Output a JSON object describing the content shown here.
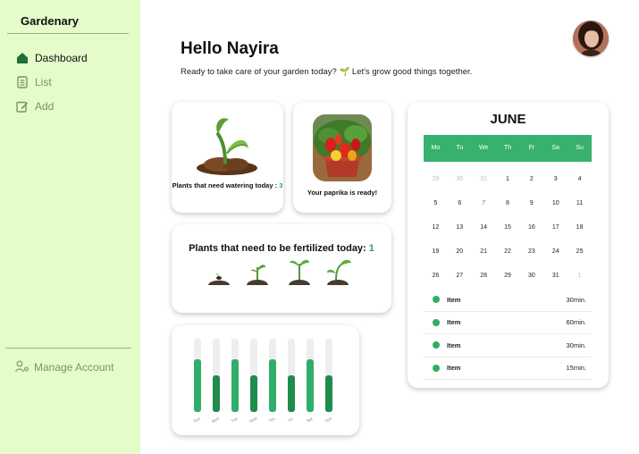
{
  "app": {
    "name": "Gardenary"
  },
  "sidebar": {
    "items": [
      {
        "label": "Dashboard",
        "icon": "home-icon",
        "active": true
      },
      {
        "label": "List",
        "icon": "list-icon",
        "active": false
      },
      {
        "label": "Add",
        "icon": "edit-icon",
        "active": false
      }
    ],
    "manage_account": {
      "label": "Manage Account",
      "icon": "user-gear-icon"
    }
  },
  "header": {
    "greeting": "Hello Nayira",
    "subtitle": "Ready to take care of your garden today? 🌱 Let's grow good things together."
  },
  "cards": {
    "watering": {
      "label": "Plants that need watering today :",
      "count": "3",
      "icon": "sprout-soil-icon"
    },
    "paprika": {
      "label": "Your paprika is ready!",
      "image": "paprika-plant-photo"
    },
    "fertilize": {
      "label": "Plants that need to be fertilized today:",
      "count": "1",
      "icons": [
        "seed-stage-1-icon",
        "seed-stage-2-icon",
        "seed-stage-3-icon",
        "seed-stage-4-icon"
      ]
    }
  },
  "chart_data": {
    "type": "bar",
    "categories": [
      "Sun",
      "Mon",
      "Tue",
      "Wed",
      "Thu",
      "Fri",
      "Sat",
      "Sun"
    ],
    "values": [
      0.72,
      0.5,
      0.72,
      0.5,
      0.72,
      0.5,
      0.72,
      0.5
    ],
    "ylim": [
      0,
      1
    ],
    "colors": {
      "high": "#2fae6b",
      "low": "#1f8b4d",
      "track": "#eeeeee"
    }
  },
  "calendar": {
    "month": "JUNE",
    "weekdays": [
      "Mo",
      "Tu",
      "We",
      "Th",
      "Fr",
      "Sa",
      "Su"
    ],
    "days": [
      {
        "d": "29",
        "muted": true
      },
      {
        "d": "30",
        "muted": true
      },
      {
        "d": "31",
        "muted": true
      },
      {
        "d": "1"
      },
      {
        "d": "2"
      },
      {
        "d": "3"
      },
      {
        "d": "4"
      },
      {
        "d": "5"
      },
      {
        "d": "6"
      },
      {
        "d": "7",
        "today": true
      },
      {
        "d": "8"
      },
      {
        "d": "9"
      },
      {
        "d": "10"
      },
      {
        "d": "11"
      },
      {
        "d": "12"
      },
      {
        "d": "13"
      },
      {
        "d": "14"
      },
      {
        "d": "15"
      },
      {
        "d": "16"
      },
      {
        "d": "17"
      },
      {
        "d": "18"
      },
      {
        "d": "19"
      },
      {
        "d": "20"
      },
      {
        "d": "21"
      },
      {
        "d": "22"
      },
      {
        "d": "23"
      },
      {
        "d": "24"
      },
      {
        "d": "25"
      },
      {
        "d": "26"
      },
      {
        "d": "27"
      },
      {
        "d": "28"
      },
      {
        "d": "29"
      },
      {
        "d": "30"
      },
      {
        "d": "31"
      },
      {
        "d": "1",
        "muted": true
      }
    ],
    "tasks": [
      {
        "name": "Item",
        "duration": "30min."
      },
      {
        "name": "Item",
        "duration": "60min."
      },
      {
        "name": "Item",
        "duration": "30min."
      },
      {
        "name": "Item",
        "duration": "15min."
      }
    ]
  },
  "colors": {
    "sidebar_bg": "#e3fcc9",
    "accent": "#38b16f",
    "accent_dark": "#1f8b4d"
  }
}
